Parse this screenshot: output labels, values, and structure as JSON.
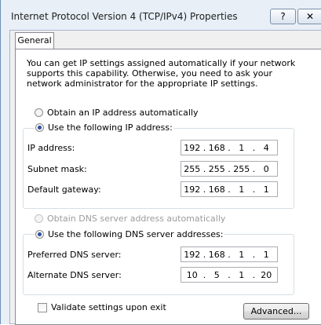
{
  "window": {
    "title": "Internet Protocol Version 4 (TCP/IPv4) Properties",
    "help_label": "?",
    "close_label": "✕"
  },
  "tabs": [
    {
      "label": "General",
      "selected": true
    }
  ],
  "intro": "You can get IP settings assigned automatically if your network supports this capability. Otherwise, you need to ask your network administrator for the appropriate IP settings.",
  "ip_group": {
    "auto_label": "Obtain an IP address automatically",
    "auto_selected": false,
    "manual_label": "Use the following IP address:",
    "manual_selected": true,
    "fields": [
      {
        "label": "IP address:",
        "octets": [
          "192",
          "168",
          "1",
          "4"
        ]
      },
      {
        "label": "Subnet mask:",
        "octets": [
          "255",
          "255",
          "255",
          "0"
        ]
      },
      {
        "label": "Default gateway:",
        "octets": [
          "192",
          "168",
          "1",
          "1"
        ]
      }
    ]
  },
  "dns_group": {
    "auto_label": "Obtain DNS server address automatically",
    "auto_selected": false,
    "auto_enabled": false,
    "manual_label": "Use the following DNS server addresses:",
    "manual_selected": true,
    "fields": [
      {
        "label": "Preferred DNS server:",
        "octets": [
          "192",
          "168",
          "1",
          "1"
        ]
      },
      {
        "label": "Alternate DNS server:",
        "octets": [
          "10",
          "5",
          "1",
          "20"
        ]
      }
    ]
  },
  "validate": {
    "label": "Validate settings upon exit",
    "checked": false
  },
  "advanced_label": "Advanced..."
}
